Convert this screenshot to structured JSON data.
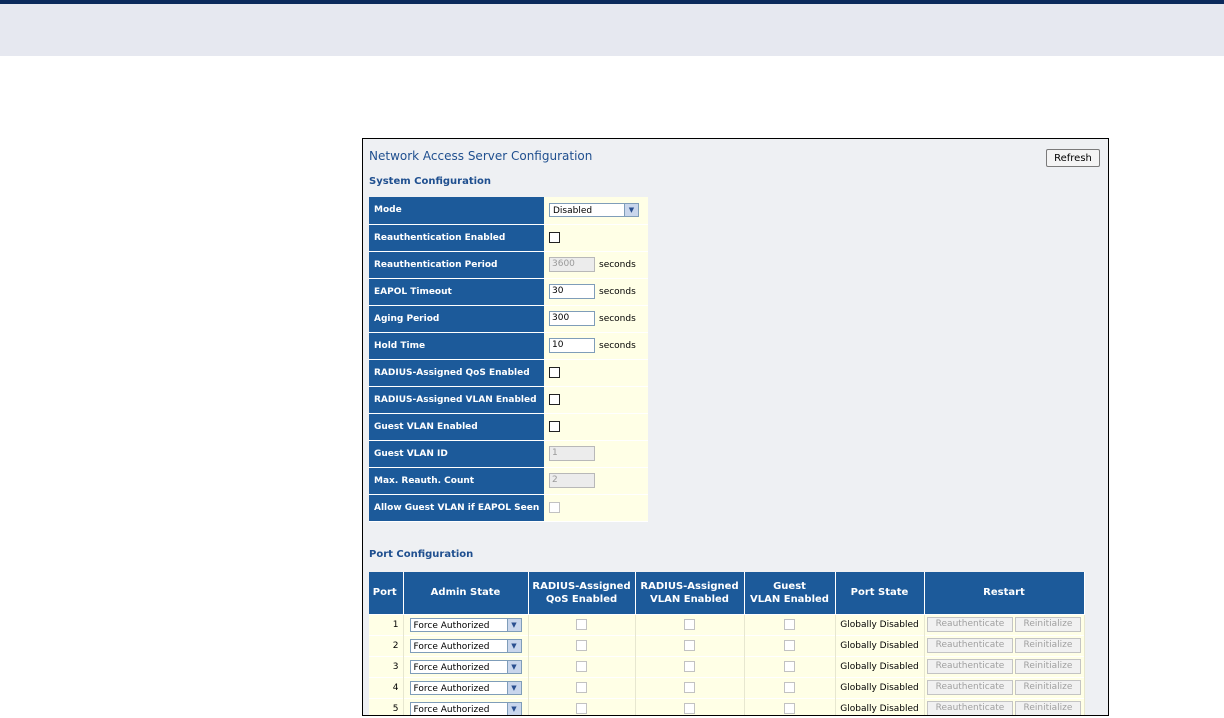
{
  "page_title": "Network Access Server Configuration",
  "refresh_label": "Refresh",
  "system_section_title": "System Configuration",
  "system_rows": {
    "mode": {
      "label": "Mode",
      "value": "Disabled"
    },
    "reauth_enabled": {
      "label": "Reauthentication Enabled",
      "checked": false
    },
    "reauth_period": {
      "label": "Reauthentication Period",
      "value": "3600",
      "unit": "seconds"
    },
    "eapol_timeout": {
      "label": "EAPOL Timeout",
      "value": "30",
      "unit": "seconds"
    },
    "aging_period": {
      "label": "Aging Period",
      "value": "300",
      "unit": "seconds"
    },
    "hold_time": {
      "label": "Hold Time",
      "value": "10",
      "unit": "seconds"
    },
    "radius_qos": {
      "label": "RADIUS-Assigned QoS Enabled",
      "checked": false
    },
    "radius_vlan": {
      "label": "RADIUS-Assigned VLAN Enabled",
      "checked": false
    },
    "guest_vlan_enabled": {
      "label": "Guest VLAN Enabled",
      "checked": false
    },
    "guest_vlan_id": {
      "label": "Guest VLAN ID",
      "value": "1"
    },
    "max_reauth": {
      "label": "Max. Reauth. Count",
      "value": "2"
    },
    "allow_guest": {
      "label": "Allow Guest VLAN if EAPOL Seen",
      "checked": false
    }
  },
  "port_section_title": "Port Configuration",
  "port_headers": {
    "port": "Port",
    "admin_state": "Admin State",
    "radius_qos_l1": "RADIUS-Assigned",
    "radius_qos_l2": "QoS Enabled",
    "radius_vlan_l1": "RADIUS-Assigned",
    "radius_vlan_l2": "VLAN Enabled",
    "guest_l1": "Guest",
    "guest_l2": "VLAN Enabled",
    "port_state": "Port State",
    "restart": "Restart"
  },
  "ports": [
    {
      "port": "1",
      "admin_state": "Force Authorized",
      "port_state": "Globally Disabled",
      "reauth_label": "Reauthenticate",
      "reinit_label": "Reinitialize"
    },
    {
      "port": "2",
      "admin_state": "Force Authorized",
      "port_state": "Globally Disabled",
      "reauth_label": "Reauthenticate",
      "reinit_label": "Reinitialize"
    },
    {
      "port": "3",
      "admin_state": "Force Authorized",
      "port_state": "Globally Disabled",
      "reauth_label": "Reauthenticate",
      "reinit_label": "Reinitialize"
    },
    {
      "port": "4",
      "admin_state": "Force Authorized",
      "port_state": "Globally Disabled",
      "reauth_label": "Reauthenticate",
      "reinit_label": "Reinitialize"
    },
    {
      "port": "5",
      "admin_state": "Force Authorized",
      "port_state": "Globally Disabled",
      "reauth_label": "Reauthenticate",
      "reinit_label": "Reinitialize"
    }
  ],
  "colors": {
    "header_blue": "#1c5a9a",
    "cell_yellow": "#ffffe6",
    "title_blue": "#1f4f8f",
    "top_bar": "#0b2a5c"
  },
  "icons": {
    "dropdown": "chevron-down-icon"
  }
}
